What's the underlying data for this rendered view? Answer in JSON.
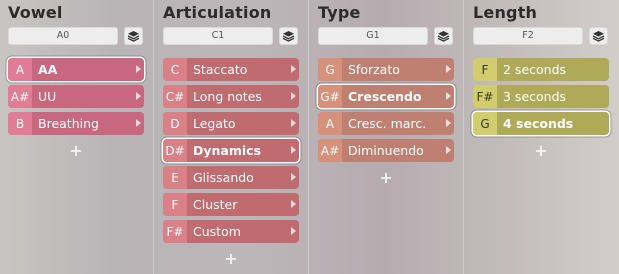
{
  "columns": [
    {
      "title": "Vowel",
      "key": "A0",
      "items": [
        {
          "note": "A",
          "label": "AA",
          "selected": true
        },
        {
          "note": "A#",
          "label": "UU",
          "selected": false
        },
        {
          "note": "B",
          "label": "Breathing",
          "selected": false
        }
      ],
      "add": "+"
    },
    {
      "title": "Articulation",
      "key": "C1",
      "items": [
        {
          "note": "C",
          "label": "Staccato",
          "selected": false
        },
        {
          "note": "C#",
          "label": "Long notes",
          "selected": false
        },
        {
          "note": "D",
          "label": "Legato",
          "selected": false
        },
        {
          "note": "D#",
          "label": "Dynamics",
          "selected": true
        },
        {
          "note": "E",
          "label": "Glissando",
          "selected": false
        },
        {
          "note": "F",
          "label": "Cluster",
          "selected": false
        },
        {
          "note": "F#",
          "label": "Custom",
          "selected": false
        }
      ],
      "add": "+"
    },
    {
      "title": "Type",
      "key": "G1",
      "items": [
        {
          "note": "G",
          "label": "Sforzato",
          "selected": false
        },
        {
          "note": "G#",
          "label": "Crescendo",
          "selected": true
        },
        {
          "note": "A",
          "label": "Cresc. marc.",
          "selected": false
        },
        {
          "note": "A#",
          "label": "Diminuendo",
          "selected": false
        }
      ],
      "add": "+"
    },
    {
      "title": "Length",
      "key": "F2",
      "items": [
        {
          "note": "F",
          "label": "2 seconds",
          "selected": false
        },
        {
          "note": "F#",
          "label": "3 seconds",
          "selected": false
        },
        {
          "note": "G",
          "label": "4 seconds",
          "selected": true
        }
      ],
      "add": "+"
    }
  ],
  "icons": {
    "layer": "layers-icon",
    "chevron": "chevron-right-icon",
    "add": "plus-icon"
  },
  "colors": {
    "vowel": "#c8677e",
    "articulation": "#c06b6f",
    "type": "#c08071",
    "length": "#aeaa58"
  }
}
